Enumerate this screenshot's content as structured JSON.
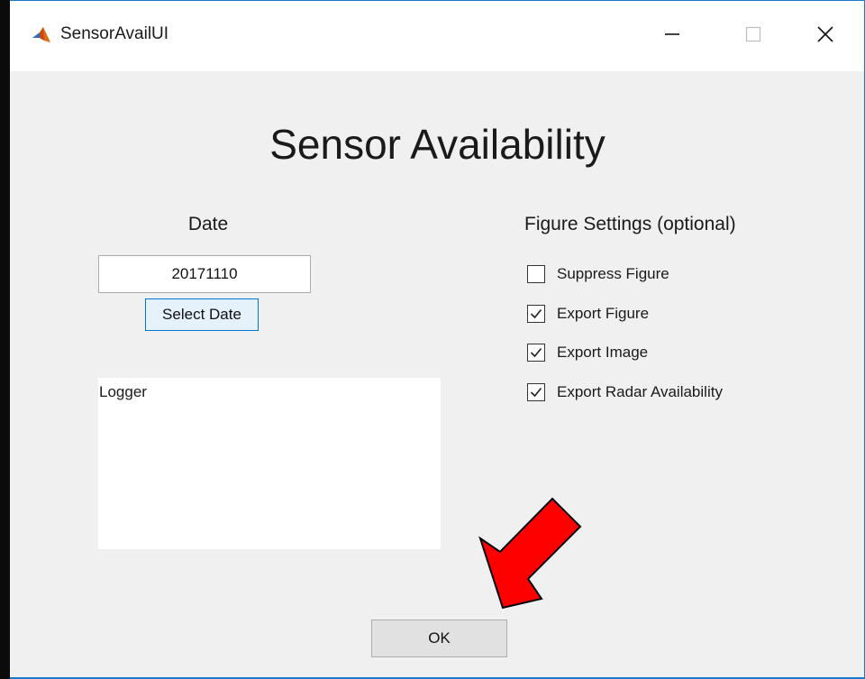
{
  "window": {
    "title": "SensorAvailUI",
    "accent": "#1979ca"
  },
  "heading": "Sensor Availability",
  "date": {
    "label": "Date",
    "value": "20171110",
    "select_button_label": "Select Date"
  },
  "logger": {
    "text": "Logger"
  },
  "figure_settings": {
    "heading": "Figure Settings (optional)",
    "options": [
      {
        "label": "Suppress Figure",
        "checked": false
      },
      {
        "label": "Export Figure",
        "checked": true
      },
      {
        "label": "Export Image",
        "checked": true
      },
      {
        "label": "Export Radar Availability",
        "checked": true
      }
    ]
  },
  "ok_button_label": "OK",
  "annotation": {
    "arrow_color": "#ff0000"
  },
  "icons": {
    "app": "matlab-icon",
    "minimize": "minimize-icon",
    "maximize": "maximize-icon",
    "close": "close-icon",
    "check": "checkmark-icon",
    "arrow": "red-arrow-icon"
  }
}
